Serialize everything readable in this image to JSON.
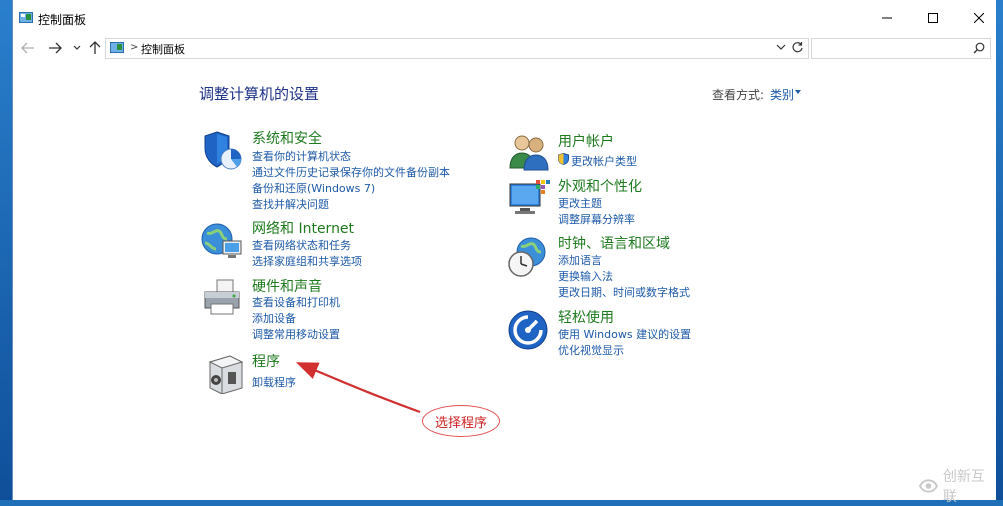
{
  "window": {
    "title": "控制面板"
  },
  "address": {
    "path": "控制面板",
    "separator": ">",
    "search_placeholder": ""
  },
  "header": {
    "title": "调整计算机的设置",
    "view_by_label": "查看方式:",
    "view_by_value": "类别"
  },
  "categories": {
    "system": {
      "title": "系统和安全",
      "links": [
        "查看你的计算机状态",
        "通过文件历史记录保存你的文件备份副本",
        "备份和还原(Windows 7)",
        "查找并解决问题"
      ]
    },
    "network": {
      "title": "网络和 Internet",
      "links": [
        "查看网络状态和任务",
        "选择家庭组和共享选项"
      ]
    },
    "hardware": {
      "title": "硬件和声音",
      "links": [
        "查看设备和打印机",
        "添加设备",
        "调整常用移动设置"
      ]
    },
    "programs": {
      "title": "程序",
      "links": [
        "卸载程序"
      ]
    },
    "users": {
      "title": "用户帐户",
      "links": [
        "更改帐户类型"
      ]
    },
    "appearance": {
      "title": "外观和个性化",
      "links": [
        "更改主题",
        "调整屏幕分辨率"
      ]
    },
    "clock": {
      "title": "时钟、语言和区域",
      "links": [
        "添加语言",
        "更换输入法",
        "更改日期、时间或数字格式"
      ]
    },
    "ease": {
      "title": "轻松使用",
      "links": [
        "使用 Windows 建议的设置",
        "优化视觉显示"
      ]
    }
  },
  "annotation": {
    "label": "选择程序",
    "color": "#cc2222"
  },
  "watermark": {
    "text": "创新互联"
  },
  "colors": {
    "category_title": "#1e7a1e",
    "link": "#1e5aa8",
    "header": "#1e3287"
  }
}
